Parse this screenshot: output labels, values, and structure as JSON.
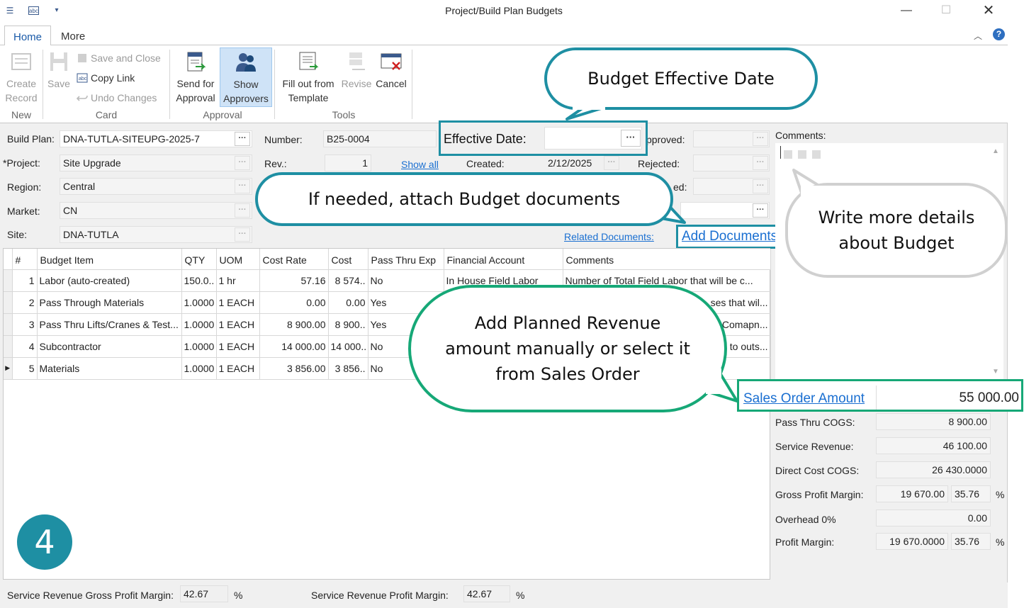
{
  "window": {
    "title": "Project/Build Plan Budgets"
  },
  "tabs": [
    "Home",
    "More"
  ],
  "ribbon": {
    "create_record": "Create\nRecord",
    "save": "Save",
    "save_and_close": "Save and Close",
    "copy_link": "Copy Link",
    "undo_changes": "Undo Changes",
    "send_for_approval": "Send for\nApproval",
    "show_approvers": "Show\nApprovers",
    "fill_out_template": "Fill out from\nTemplate",
    "revise": "Revise",
    "cancel": "Cancel",
    "groups": {
      "new": "New",
      "card": "Card",
      "approval": "Approval",
      "tools": "Tools"
    }
  },
  "form": {
    "build_plan_label": "Build Plan:",
    "build_plan_value": "DNA-TUTLA-SITEUPG-2025-7",
    "project_label": "*Project:",
    "project_value": "Site Upgrade",
    "region_label": "Region:",
    "region_value": "Central",
    "market_label": "Market:",
    "market_value": "CN",
    "site_label": "Site:",
    "site_value": "DNA-TUTLA",
    "number_label": "Number:",
    "number_value": "B25-0004",
    "rev_label": "Rev.:",
    "rev_value": "1",
    "show_all": "Show all",
    "effective_date_label": "Effective Date:",
    "effective_date_value": "",
    "created_label": "Created:",
    "created_value": "2/12/2025",
    "approved_label": "pproved:",
    "rejected_label": "Rejected:",
    "ed_label": "ed:",
    "related_documents": "Related Documents:",
    "add_documents": "Add Documents",
    "comments_label": "Comments:"
  },
  "grid": {
    "columns": [
      "#",
      "Budget Item",
      "QTY",
      "UOM",
      "Cost Rate",
      "Cost",
      "Pass Thru Exp",
      "Financial Account",
      "Comments"
    ],
    "rows": [
      {
        "num": "1",
        "item": "Labor (auto-created)",
        "qty": "150.0..",
        "uom": "1 hr",
        "rate": "57.16",
        "cost": "8 574..",
        "pass": "No",
        "account": "In House Field Labor",
        "comments": "Number of Total Field Labor that will be c..."
      },
      {
        "num": "2",
        "item": "Pass Through Materials",
        "qty": "1.0000",
        "uom": "1 EACH",
        "rate": "0.00",
        "cost": "0.00",
        "pass": "Yes",
        "account": "",
        "comments": "ses that wil..."
      },
      {
        "num": "3",
        "item": "Pass Thru Lifts/Cranes & Test...",
        "qty": "1.0000",
        "uom": "1 EACH",
        "rate": "8 900.00",
        "cost": "8 900..",
        "pass": "Yes",
        "account": "",
        "comments": "Comapn..."
      },
      {
        "num": "4",
        "item": "Subcontractor",
        "qty": "1.0000",
        "uom": "1 EACH",
        "rate": "14 000.00",
        "cost": "14 000..",
        "pass": "No",
        "account": "",
        "comments": "to outs..."
      },
      {
        "num": "5",
        "item": "Materials",
        "qty": "1.0000",
        "uom": "1 EACH",
        "rate": "3 856.00",
        "cost": "3 856..",
        "pass": "No",
        "account": "",
        "comments": ""
      }
    ]
  },
  "summary": {
    "sales_order_amount_label": "Sales Order Amount",
    "sales_order_amount": "55 000.00",
    "pass_thru_cogs_label": "Pass Thru COGS:",
    "pass_thru_cogs": "8 900.00",
    "service_revenue_label": "Service Revenue:",
    "service_revenue": "46 100.00",
    "direct_cost_cogs_label": "Direct Cost COGS:",
    "direct_cost_cogs": "26 430.0000",
    "gross_profit_margin_label": "Gross Profit Margin:",
    "gross_profit_margin": "19 670.00",
    "gross_profit_margin_pct": "35.76",
    "overhead_label": "Overhead 0%",
    "overhead": "0.00",
    "profit_margin_label": "Profit Margin:",
    "profit_margin": "19 670.0000",
    "profit_margin_pct": "35.76",
    "pct_sign": "%"
  },
  "bottom": {
    "srgpm_label": "Service Revenue Gross Profit Margin:",
    "srgpm_value": "42.67",
    "srpm_label": "Service Revenue Profit Margin:",
    "srpm_value": "42.67",
    "pct_sign": "%"
  },
  "callouts": {
    "effective_date": "Budget Effective Date",
    "attach_docs": "If needed, attach Budget documents",
    "details": "Write more details\nabout Budget",
    "revenue": "Add Planned Revenue\namount manually or select it\nfrom Sales Order"
  },
  "step_number": "4",
  "colors": {
    "teal": "#1e8fa3",
    "green": "#16a877",
    "gray_callout": "#d0d0d0",
    "link": "#1a6fd1"
  }
}
